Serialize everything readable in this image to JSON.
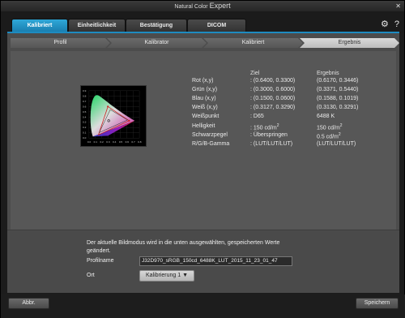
{
  "window": {
    "title_a": "Natural Color ",
    "title_b": "Expert",
    "close_glyph": "✕"
  },
  "tabs": [
    {
      "label": "Kalibriert",
      "active": true
    },
    {
      "label": "Einheitlichkeit",
      "active": false
    },
    {
      "label": "Bestätigung",
      "active": false
    },
    {
      "label": "DICOM",
      "active": false
    }
  ],
  "top_icons": [
    "gear-icon",
    "help-icon"
  ],
  "steps": [
    {
      "label": "Profil",
      "active": false
    },
    {
      "label": "Kalibrator",
      "active": false
    },
    {
      "label": "Kalibriert",
      "active": false
    },
    {
      "label": "Ergebnis",
      "active": true
    }
  ],
  "results": {
    "col_target": "Ziel",
    "col_result": "Ergebnis",
    "rows": [
      {
        "label": "Rot (x,y)",
        "target": ": (0.6400, 0.3300)",
        "result": "(0.6170, 0.3446)"
      },
      {
        "label": "Grün (x,y)",
        "target": ": (0.3000, 0.6000)",
        "result": "(0.3371, 0.5440)"
      },
      {
        "label": "Blau (x,y)",
        "target": ": (0.1500, 0.0600)",
        "result": "(0.1588, 0.1019)"
      },
      {
        "label": "Weiß (x,y)",
        "target": ": (0.3127, 0.3290)",
        "result": "(0.3130, 0.3291)"
      },
      {
        "label": "Weißpunkt",
        "target": ": D65",
        "result": "6488 K"
      },
      {
        "label": "Helligkeit",
        "target": ": 150 cd/m",
        "target_sup": "2",
        "result": "150 cd/m",
        "result_sup": "2"
      },
      {
        "label": "Schwarzpegel",
        "target": ": Überspringen",
        "result": "0.5 cd/m",
        "result_sup": "2"
      },
      {
        "label": "R/G/B-Gamma",
        "target": ": (LUT/LUT/LUT)",
        "result": "(LUT/LUT/LUT)"
      }
    ]
  },
  "gamut_chart": {
    "y_ticks": [
      "0.9",
      "0.8",
      "0.7",
      "0.6",
      "0.5",
      "0.4",
      "0.3",
      "0.2",
      "0.1",
      "0.0"
    ],
    "x_ticks": [
      "0.0",
      "0.1",
      "0.2",
      "0.3",
      "0.4",
      "0.5",
      "0.6",
      "0.7",
      "0.8"
    ]
  },
  "bottom": {
    "info": "Der aktuelle Bildmodus wird in die unten ausgewählten, gespeicherten Werte geändert.",
    "profile_label": "Profilname",
    "profile_value": "J32D970_sRGB_150cd_6488K_LUT_2015_11_23_01_47",
    "location_label": "Ort",
    "location_value": "Kalibrierung 1 ▼"
  },
  "footer": {
    "cancel_label": "Abbr.",
    "save_label": "Speichern"
  }
}
